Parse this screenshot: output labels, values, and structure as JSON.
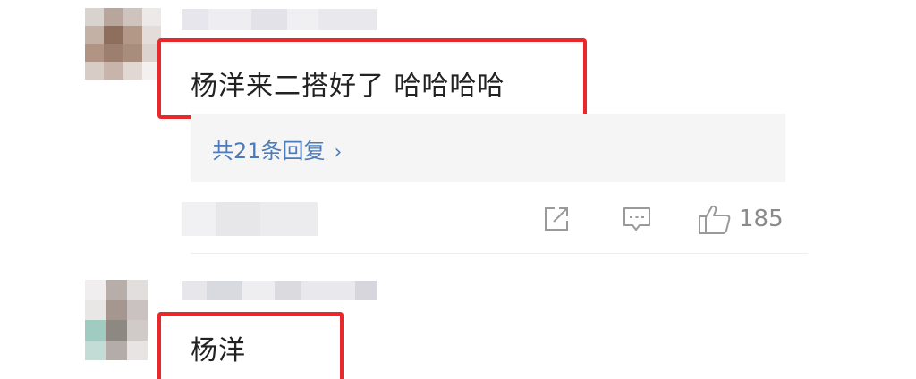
{
  "comments": [
    {
      "text": "杨洋来二搭好了 哈哈哈哈",
      "replies_label": "共21条回复",
      "replies_chevron": "›",
      "likes": "185"
    },
    {
      "text": "杨洋"
    }
  ],
  "colors": {
    "highlight_box": "#e8282a",
    "link": "#4a7bbd",
    "meta_text": "#8a8a8a",
    "panel_bg": "#f5f5f5"
  },
  "icons": {
    "share": "share-icon",
    "comment": "comment-icon",
    "like": "thumbs-up-icon"
  }
}
